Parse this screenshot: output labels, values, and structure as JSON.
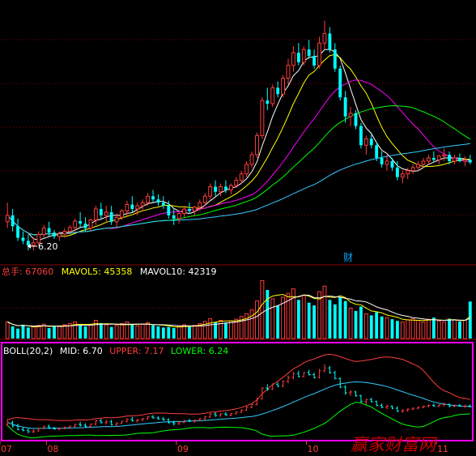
{
  "chart_data": [
    {
      "type": "candlestick",
      "panel": "price",
      "x_month_labels": [
        "07",
        "08",
        "09",
        "10",
        "11"
      ],
      "annotations": {
        "low_label": "6.20",
        "marker_text": "财"
      },
      "colors": {
        "up": "#ff3c3c",
        "down": "#00ffff",
        "ma5": "#ffffff",
        "ma10": "#ffff00",
        "ma20": "#ff00ff",
        "ma30": "#00ff00",
        "ma60": "#33ccff"
      },
      "moving_averages": [
        "MA5",
        "MA10",
        "MA20",
        "MA30",
        "MA60"
      ],
      "candles_ohlc": [
        [
          6.65,
          6.95,
          6.55,
          6.75
        ],
        [
          6.75,
          6.85,
          6.5,
          6.58
        ],
        [
          6.58,
          6.7,
          6.35,
          6.4
        ],
        [
          6.4,
          6.5,
          6.3,
          6.35
        ],
        [
          6.35,
          6.45,
          6.2,
          6.28
        ],
        [
          6.28,
          6.4,
          6.2,
          6.32
        ],
        [
          6.32,
          6.5,
          6.28,
          6.45
        ],
        [
          6.45,
          6.6,
          6.4,
          6.55
        ],
        [
          6.55,
          6.65,
          6.42,
          6.48
        ],
        [
          6.48,
          6.52,
          6.38,
          6.42
        ],
        [
          6.42,
          6.5,
          6.35,
          6.46
        ],
        [
          6.46,
          6.55,
          6.4,
          6.5
        ],
        [
          6.5,
          6.6,
          6.45,
          6.56
        ],
        [
          6.56,
          6.7,
          6.5,
          6.66
        ],
        [
          6.66,
          6.8,
          6.55,
          6.62
        ],
        [
          6.62,
          6.72,
          6.5,
          6.55
        ],
        [
          6.55,
          6.7,
          6.5,
          6.68
        ],
        [
          6.68,
          6.9,
          6.6,
          6.85
        ],
        [
          6.85,
          6.95,
          6.7,
          6.75
        ],
        [
          6.75,
          6.9,
          6.65,
          6.8
        ],
        [
          6.8,
          6.9,
          6.6,
          6.65
        ],
        [
          6.65,
          6.78,
          6.55,
          6.72
        ],
        [
          6.72,
          6.85,
          6.68,
          6.82
        ],
        [
          6.82,
          6.98,
          6.75,
          6.92
        ],
        [
          6.92,
          7.05,
          6.8,
          6.85
        ],
        [
          6.85,
          6.95,
          6.75,
          6.9
        ],
        [
          6.9,
          7.0,
          6.82,
          6.95
        ],
        [
          6.95,
          7.1,
          6.9,
          7.05
        ],
        [
          7.05,
          7.15,
          6.95,
          7.0
        ],
        [
          7.0,
          7.08,
          6.9,
          6.95
        ],
        [
          6.95,
          7.05,
          6.85,
          6.9
        ],
        [
          6.9,
          6.98,
          6.7,
          6.75
        ],
        [
          6.75,
          6.85,
          6.6,
          6.7
        ],
        [
          6.7,
          6.82,
          6.62,
          6.78
        ],
        [
          6.78,
          6.9,
          6.72,
          6.85
        ],
        [
          6.85,
          6.95,
          6.78,
          6.82
        ],
        [
          6.82,
          6.9,
          6.75,
          6.88
        ],
        [
          6.88,
          7.0,
          6.82,
          6.95
        ],
        [
          6.95,
          7.1,
          6.9,
          7.05
        ],
        [
          7.05,
          7.25,
          7.0,
          7.2
        ],
        [
          7.2,
          7.3,
          7.05,
          7.12
        ],
        [
          7.12,
          7.25,
          7.05,
          7.2
        ],
        [
          7.2,
          7.3,
          7.1,
          7.15
        ],
        [
          7.15,
          7.25,
          7.08,
          7.22
        ],
        [
          7.22,
          7.35,
          7.18,
          7.3
        ],
        [
          7.3,
          7.45,
          7.25,
          7.4
        ],
        [
          7.4,
          7.6,
          7.35,
          7.55
        ],
        [
          7.55,
          7.75,
          7.5,
          7.7
        ],
        [
          7.7,
          8.05,
          7.65,
          8.0
        ],
        [
          8.0,
          8.6,
          7.95,
          8.55
        ],
        [
          8.55,
          8.75,
          8.4,
          8.5
        ],
        [
          8.5,
          8.8,
          8.45,
          8.75
        ],
        [
          8.75,
          8.85,
          8.6,
          8.65
        ],
        [
          8.65,
          8.95,
          8.6,
          8.9
        ],
        [
          8.9,
          9.2,
          8.8,
          9.1
        ],
        [
          9.1,
          9.4,
          9.0,
          9.3
        ],
        [
          9.3,
          9.45,
          9.1,
          9.15
        ],
        [
          9.15,
          9.4,
          9.1,
          9.35
        ],
        [
          9.35,
          9.5,
          9.2,
          9.25
        ],
        [
          9.25,
          9.35,
          9.05,
          9.1
        ],
        [
          9.1,
          9.55,
          9.05,
          9.45
        ],
        [
          9.45,
          9.8,
          9.35,
          9.6
        ],
        [
          9.6,
          9.7,
          9.3,
          9.35
        ],
        [
          9.35,
          9.45,
          9.0,
          9.05
        ],
        [
          9.05,
          9.1,
          8.55,
          8.6
        ],
        [
          8.6,
          8.7,
          8.2,
          8.3
        ],
        [
          8.3,
          8.45,
          8.15,
          8.35
        ],
        [
          8.35,
          8.4,
          8.1,
          8.15
        ],
        [
          8.15,
          8.2,
          7.8,
          7.85
        ],
        [
          7.85,
          8.0,
          7.7,
          7.95
        ],
        [
          7.95,
          8.05,
          7.8,
          7.85
        ],
        [
          7.85,
          7.9,
          7.6,
          7.65
        ],
        [
          7.65,
          7.75,
          7.5,
          7.55
        ],
        [
          7.55,
          7.7,
          7.45,
          7.6
        ],
        [
          7.6,
          7.65,
          7.45,
          7.5
        ],
        [
          7.5,
          7.6,
          7.3,
          7.35
        ],
        [
          7.35,
          7.45,
          7.25,
          7.4
        ],
        [
          7.4,
          7.5,
          7.32,
          7.45
        ],
        [
          7.45,
          7.55,
          7.4,
          7.5
        ],
        [
          7.5,
          7.6,
          7.45,
          7.55
        ],
        [
          7.55,
          7.65,
          7.5,
          7.6
        ],
        [
          7.6,
          7.7,
          7.55,
          7.65
        ],
        [
          7.65,
          7.75,
          7.58,
          7.62
        ],
        [
          7.62,
          7.7,
          7.55,
          7.68
        ],
        [
          7.68,
          7.8,
          7.6,
          7.7
        ],
        [
          7.7,
          7.75,
          7.55,
          7.6
        ],
        [
          7.6,
          7.7,
          7.55,
          7.65
        ],
        [
          7.65,
          7.72,
          7.58,
          7.6
        ],
        [
          7.6,
          7.68,
          7.52,
          7.62
        ],
        [
          7.62,
          7.7,
          7.55,
          7.58
        ]
      ]
    },
    {
      "type": "bar",
      "panel": "volume",
      "legend": {
        "total_label": "总手: 67060",
        "mavol5": "MAVOL5: 45358",
        "mavol10": "MAVOL10: 42319"
      },
      "colors": {
        "total": "#ff3c3c",
        "mavol5": "#ffff00",
        "mavol10": "#ffffff"
      },
      "values": [
        30000,
        22000,
        18000,
        25000,
        20000,
        21000,
        24000,
        26000,
        19000,
        22000,
        23000,
        25000,
        27000,
        30000,
        24000,
        22000,
        26000,
        33000,
        28000,
        25000,
        21000,
        24000,
        27000,
        30000,
        25000,
        23000,
        26000,
        29000,
        24000,
        22000,
        20000,
        21000,
        19000,
        23000,
        25000,
        22000,
        24000,
        27000,
        31000,
        36000,
        30000,
        33000,
        29000,
        32000,
        35000,
        40000,
        45000,
        52000,
        68000,
        105000,
        88000,
        72000,
        60000,
        75000,
        82000,
        90000,
        70000,
        78000,
        65000,
        60000,
        85000,
        95000,
        70000,
        62000,
        75000,
        68000,
        55000,
        50000,
        58000,
        45000,
        42000,
        48000,
        40000,
        38000,
        35000,
        32000,
        30000,
        34000,
        36000,
        33000,
        30000,
        35000,
        38000,
        32000,
        30000,
        36000,
        34000,
        31000,
        33000,
        67060
      ],
      "ylim": [
        0,
        110000
      ]
    },
    {
      "type": "line",
      "panel": "boll",
      "legend": {
        "name": "BOLL(20,2)",
        "mid": "MID: 6.70",
        "upper": "UPPER: 7.17",
        "lower": "LOWER: 6.24"
      },
      "colors": {
        "mid": "#33ccff",
        "upper": "#ff3c3c",
        "lower": "#00ff00",
        "name": "#ffffff"
      }
    }
  ],
  "watermark": "赢家财富网"
}
